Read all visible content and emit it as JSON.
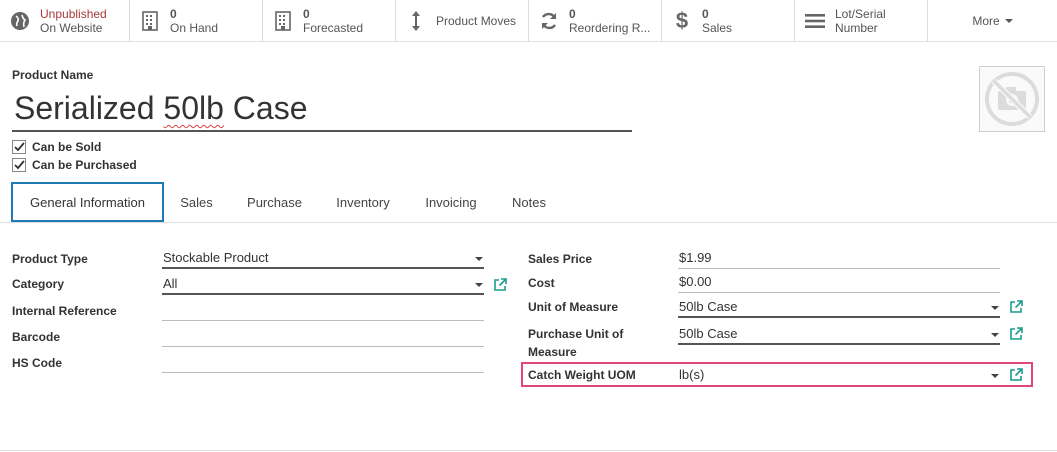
{
  "smart_buttons": {
    "website": {
      "line1": "Unpublished",
      "line2": "On Website"
    },
    "on_hand": {
      "value": "0",
      "label": "On Hand"
    },
    "forecasted": {
      "value": "0",
      "label": "Forecasted"
    },
    "product_moves": {
      "label": "Product Moves"
    },
    "reordering": {
      "value": "0",
      "label": "Reordering R..."
    },
    "sales": {
      "value": "0",
      "label": "Sales"
    },
    "lot_serial": {
      "line1": "Lot/Serial",
      "line2": "Number"
    },
    "more": {
      "label": "More"
    }
  },
  "product": {
    "name_label": "Product Name",
    "name_word1": "Serialized",
    "name_word2": "50lb",
    "name_word3": "Case",
    "can_be_sold": "Can be Sold",
    "can_be_purchased": "Can be Purchased"
  },
  "tabs": [
    "General Information",
    "Sales",
    "Purchase",
    "Inventory",
    "Invoicing",
    "Notes"
  ],
  "left_fields": {
    "product_type": {
      "label": "Product Type",
      "value": "Stockable Product"
    },
    "category": {
      "label": "Category",
      "value": "All"
    },
    "internal_reference": {
      "label": "Internal Reference",
      "value": ""
    },
    "barcode": {
      "label": "Barcode",
      "value": ""
    },
    "hs_code": {
      "label": "HS Code",
      "value": ""
    }
  },
  "right_fields": {
    "sales_price": {
      "label": "Sales Price",
      "value": "$1.99"
    },
    "cost": {
      "label": "Cost",
      "value": "$0.00"
    },
    "uom": {
      "label": "Unit of Measure",
      "value": "50lb Case"
    },
    "purchase_uom": {
      "label_line1": "Purchase Unit of",
      "label_line2": "Measure",
      "value": "50lb Case"
    },
    "catch_weight_uom": {
      "label": "Catch Weight UOM",
      "value": "lb(s)"
    }
  },
  "colors": {
    "accent": "#1d7ab6",
    "highlight": "#e0467a",
    "external_link": "#1a9c8c",
    "unpublished": "#a83a3a"
  }
}
